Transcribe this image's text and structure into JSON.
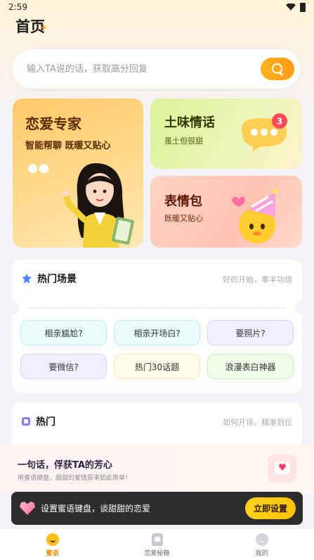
{
  "status_bar": {
    "time": "2:59"
  },
  "header": {
    "title": "首页"
  },
  "search": {
    "placeholder": "输入TA说的话，获取高分回复"
  },
  "cards": {
    "love_expert": {
      "title": "恋爱专家",
      "subtitle": "智能帮聊 既暖又贴心"
    },
    "tuwei": {
      "title": "土味情话",
      "subtitle": "虽土但很甜",
      "badge": "3"
    },
    "emoji": {
      "title": "表情包",
      "subtitle": "既暖又贴心"
    }
  },
  "hot_scenes": {
    "title": "热门场景",
    "subtitle": "好的开始，事半功倍",
    "tags": [
      "相亲尴尬?",
      "相亲开场白?",
      "要照片?",
      "要微信?",
      "热门30话题",
      "浪漫表白神器"
    ]
  },
  "hot": {
    "title": "热门",
    "subtitle": "如何开场，精准到位"
  },
  "promo": {
    "title": "一句话，俘获TA的芳心",
    "subtitle": "用蜜语键盘，甜甜的爱情原来如此简单！"
  },
  "toast": {
    "text": "设置蜜语键盘，谈甜甜的恋爱",
    "button": "立即设置"
  },
  "tabbar": {
    "items": [
      "蜜语",
      "恋爱秘籍",
      "我的"
    ],
    "active": 0
  },
  "colors": {
    "accent": "#ff9b14",
    "active_tab": "#f08a00"
  }
}
